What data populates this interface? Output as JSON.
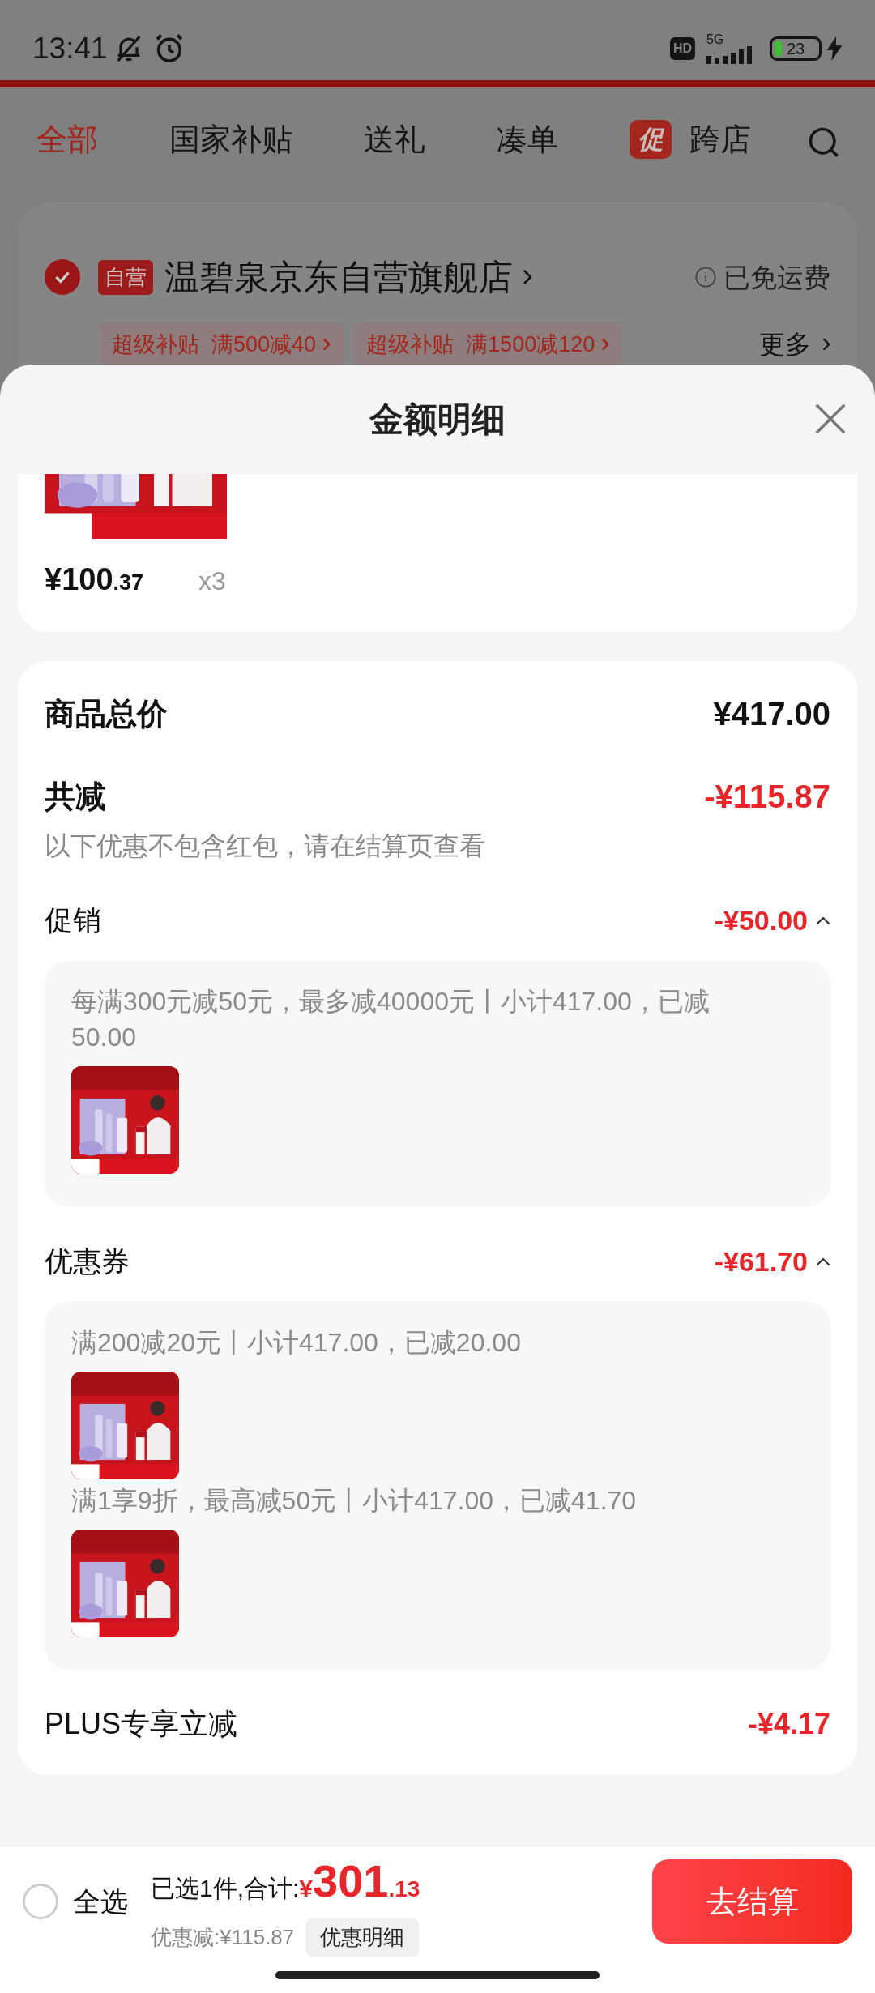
{
  "status_bar": {
    "time": "13:41",
    "hd_badge": "HD",
    "network": "5G",
    "battery": "23"
  },
  "tabs": [
    {
      "label": "全部",
      "selected": true
    },
    {
      "label": "国家补贴",
      "selected": false
    },
    {
      "label": "送礼",
      "selected": false
    },
    {
      "label": "凑单",
      "selected": false
    },
    {
      "label": "跨店",
      "badge": "促",
      "selected": false
    }
  ],
  "store": {
    "checked": true,
    "badge": "自营",
    "name": "温碧泉京东自营旗舰店",
    "shipping": "已免运费",
    "promos": [
      "超级补贴  满500减40",
      "超级补贴  满1500减120"
    ],
    "more": "更多"
  },
  "sheet": {
    "title": "金额明细",
    "product": {
      "kind": "picture",
      "price_int": "¥100",
      "price_dec": ".37",
      "quantity": "x3"
    },
    "summary": {
      "total_label": "商品总价",
      "total_value": "¥417.00",
      "discount_label": "共减",
      "discount_value": "-¥115.87",
      "note": "以下优惠不包含红包，请在结算页查看",
      "sections": [
        {
          "title": "促销",
          "amount": "-¥50.00",
          "expanded": true,
          "rules": [
            {
              "text": "每满300元减50元，最多减40000元丨小计417.00，已减50.00"
            }
          ]
        },
        {
          "title": "优惠券",
          "amount": "-¥61.70",
          "expanded": true,
          "rules": [
            {
              "text": "满200减20元丨小计417.00，已减20.00"
            },
            {
              "text": "满1享9折，最高减50元丨小计417.00，已减41.70"
            }
          ]
        }
      ],
      "plus": {
        "label": "PLUS专享立减",
        "amount": "-¥4.17"
      }
    }
  },
  "bottom_bar": {
    "select_all": {
      "label": "全选",
      "checked": false
    },
    "selected_text": "已选1件,合计:",
    "currency": "¥",
    "total_int": "301",
    "total_dec": ".13",
    "saving": "优惠减:¥115.87",
    "detail_button": "优惠明细",
    "checkout": "去结算"
  }
}
